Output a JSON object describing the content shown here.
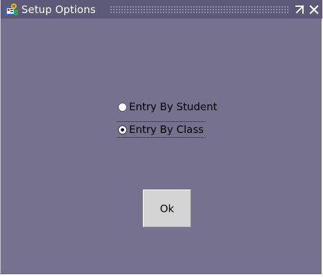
{
  "window": {
    "title": "Setup Options",
    "title_icon": "app-icon",
    "maximize_icon": "maximize-icon",
    "close_icon": "close-icon"
  },
  "options": {
    "items": [
      {
        "label": "Entry By Student",
        "selected": false
      },
      {
        "label": "Entry By Class",
        "selected": true
      }
    ]
  },
  "buttons": {
    "ok_label": "Ok"
  },
  "colors": {
    "window_background": "#75718f",
    "titlebar_background": "#5c5878",
    "button_face": "#d4d4d4"
  }
}
